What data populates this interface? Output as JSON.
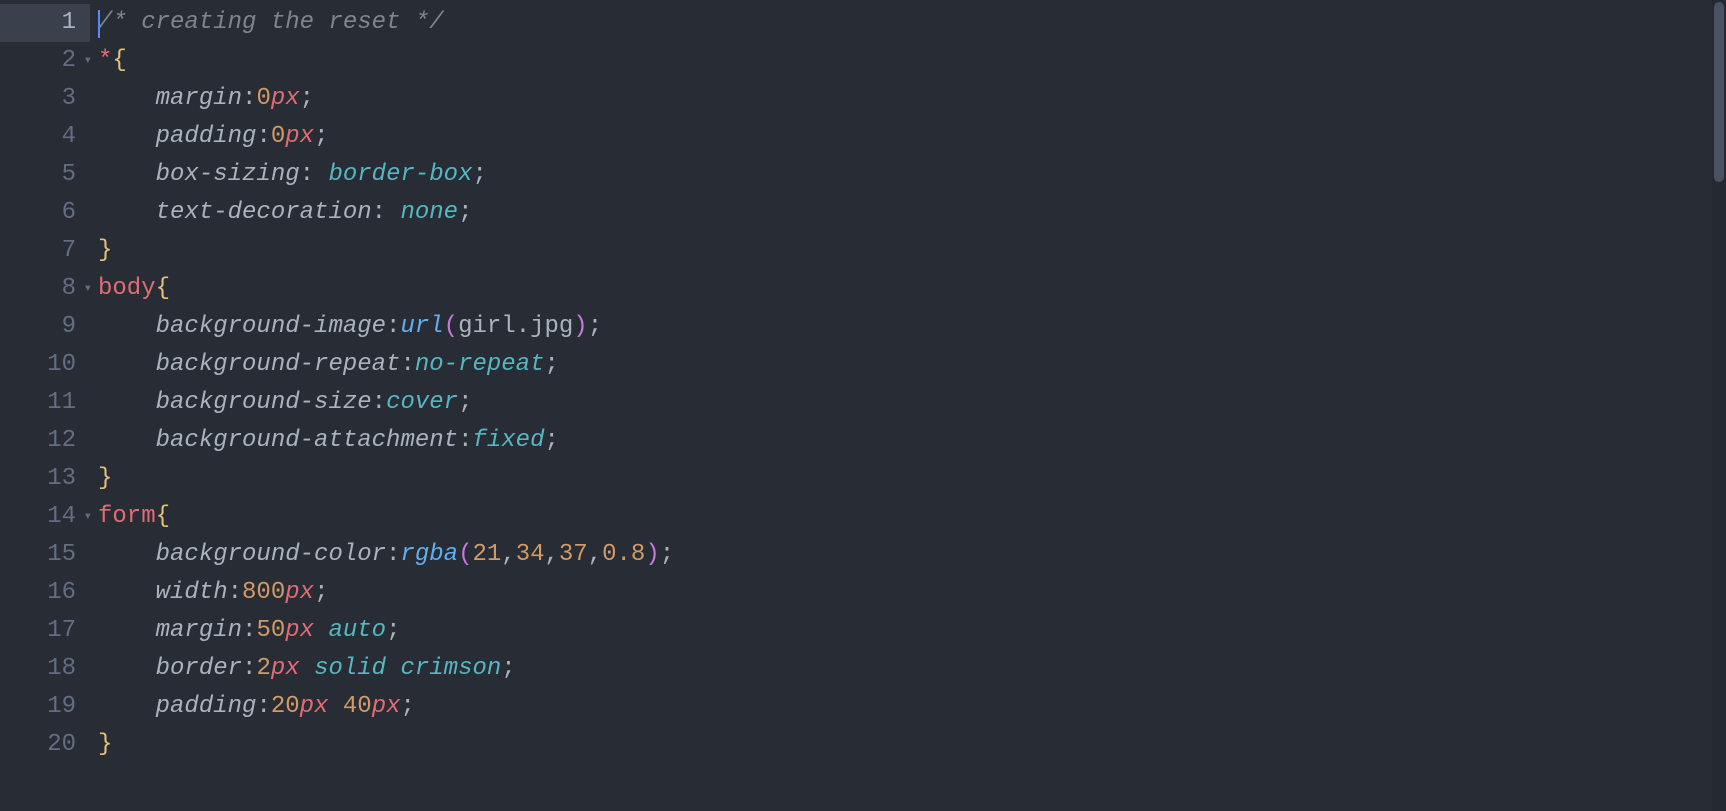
{
  "editor": {
    "language": "css",
    "active_line": 1,
    "cursor_line": 1,
    "cursor_col": 0,
    "fold_lines": [
      2,
      8,
      14
    ],
    "lines": [
      {
        "num": 1,
        "tokens": [
          {
            "t": "comment",
            "v": "/* creating the reset */"
          }
        ]
      },
      {
        "num": 2,
        "tokens": [
          {
            "t": "selector",
            "v": "*"
          },
          {
            "t": "brace",
            "v": "{"
          }
        ]
      },
      {
        "num": 3,
        "tokens": [
          {
            "t": "indent",
            "v": "    "
          },
          {
            "t": "prop",
            "v": "margin"
          },
          {
            "t": "punct",
            "v": ":"
          },
          {
            "t": "number",
            "v": "0"
          },
          {
            "t": "unit",
            "v": "px"
          },
          {
            "t": "punct",
            "v": ";"
          }
        ]
      },
      {
        "num": 4,
        "tokens": [
          {
            "t": "indent",
            "v": "    "
          },
          {
            "t": "prop",
            "v": "padding"
          },
          {
            "t": "punct",
            "v": ":"
          },
          {
            "t": "number",
            "v": "0"
          },
          {
            "t": "unit",
            "v": "px"
          },
          {
            "t": "punct",
            "v": ";"
          }
        ]
      },
      {
        "num": 5,
        "tokens": [
          {
            "t": "indent",
            "v": "    "
          },
          {
            "t": "prop",
            "v": "box-sizing"
          },
          {
            "t": "punct",
            "v": ": "
          },
          {
            "t": "const",
            "v": "border-box"
          },
          {
            "t": "punct",
            "v": ";"
          }
        ]
      },
      {
        "num": 6,
        "tokens": [
          {
            "t": "indent",
            "v": "    "
          },
          {
            "t": "prop",
            "v": "text-decoration"
          },
          {
            "t": "punct",
            "v": ": "
          },
          {
            "t": "const",
            "v": "none"
          },
          {
            "t": "punct",
            "v": ";"
          }
        ]
      },
      {
        "num": 7,
        "tokens": [
          {
            "t": "brace",
            "v": "}"
          }
        ]
      },
      {
        "num": 8,
        "tokens": [
          {
            "t": "selector",
            "v": "body"
          },
          {
            "t": "brace",
            "v": "{"
          }
        ]
      },
      {
        "num": 9,
        "tokens": [
          {
            "t": "indent",
            "v": "    "
          },
          {
            "t": "prop",
            "v": "background-image"
          },
          {
            "t": "punct",
            "v": ":"
          },
          {
            "t": "func",
            "v": "url"
          },
          {
            "t": "paren",
            "v": "("
          },
          {
            "t": "string",
            "v": "girl.jpg"
          },
          {
            "t": "paren",
            "v": ")"
          },
          {
            "t": "punct",
            "v": ";"
          }
        ]
      },
      {
        "num": 10,
        "tokens": [
          {
            "t": "indent",
            "v": "    "
          },
          {
            "t": "prop",
            "v": "background-repeat"
          },
          {
            "t": "punct",
            "v": ":"
          },
          {
            "t": "const",
            "v": "no-repeat"
          },
          {
            "t": "punct",
            "v": ";"
          }
        ]
      },
      {
        "num": 11,
        "tokens": [
          {
            "t": "indent",
            "v": "    "
          },
          {
            "t": "prop",
            "v": "background-size"
          },
          {
            "t": "punct",
            "v": ":"
          },
          {
            "t": "const",
            "v": "cover"
          },
          {
            "t": "punct",
            "v": ";"
          }
        ]
      },
      {
        "num": 12,
        "tokens": [
          {
            "t": "indent",
            "v": "    "
          },
          {
            "t": "prop",
            "v": "background-attachment"
          },
          {
            "t": "punct",
            "v": ":"
          },
          {
            "t": "const",
            "v": "fixed"
          },
          {
            "t": "punct",
            "v": ";"
          }
        ]
      },
      {
        "num": 13,
        "tokens": [
          {
            "t": "brace",
            "v": "}"
          }
        ]
      },
      {
        "num": 14,
        "tokens": [
          {
            "t": "selector",
            "v": "form"
          },
          {
            "t": "brace",
            "v": "{"
          }
        ]
      },
      {
        "num": 15,
        "tokens": [
          {
            "t": "indent",
            "v": "    "
          },
          {
            "t": "prop",
            "v": "background-color"
          },
          {
            "t": "punct",
            "v": ":"
          },
          {
            "t": "func",
            "v": "rgba"
          },
          {
            "t": "paren",
            "v": "("
          },
          {
            "t": "number",
            "v": "21"
          },
          {
            "t": "sep",
            "v": ","
          },
          {
            "t": "number",
            "v": "34"
          },
          {
            "t": "sep",
            "v": ","
          },
          {
            "t": "number",
            "v": "37"
          },
          {
            "t": "sep",
            "v": ","
          },
          {
            "t": "number",
            "v": "0.8"
          },
          {
            "t": "paren",
            "v": ")"
          },
          {
            "t": "punct",
            "v": ";"
          }
        ]
      },
      {
        "num": 16,
        "tokens": [
          {
            "t": "indent",
            "v": "    "
          },
          {
            "t": "prop",
            "v": "width"
          },
          {
            "t": "punct",
            "v": ":"
          },
          {
            "t": "number",
            "v": "800"
          },
          {
            "t": "unit",
            "v": "px"
          },
          {
            "t": "punct",
            "v": ";"
          }
        ]
      },
      {
        "num": 17,
        "tokens": [
          {
            "t": "indent",
            "v": "    "
          },
          {
            "t": "prop",
            "v": "margin"
          },
          {
            "t": "punct",
            "v": ":"
          },
          {
            "t": "number",
            "v": "50"
          },
          {
            "t": "unit",
            "v": "px"
          },
          {
            "t": "plain",
            "v": " "
          },
          {
            "t": "const",
            "v": "auto"
          },
          {
            "t": "punct",
            "v": ";"
          }
        ]
      },
      {
        "num": 18,
        "tokens": [
          {
            "t": "indent",
            "v": "    "
          },
          {
            "t": "prop",
            "v": "border"
          },
          {
            "t": "punct",
            "v": ":"
          },
          {
            "t": "number",
            "v": "2"
          },
          {
            "t": "unit",
            "v": "px"
          },
          {
            "t": "plain",
            "v": " "
          },
          {
            "t": "const",
            "v": "solid crimson"
          },
          {
            "t": "punct",
            "v": ";"
          }
        ]
      },
      {
        "num": 19,
        "tokens": [
          {
            "t": "indent",
            "v": "    "
          },
          {
            "t": "prop",
            "v": "padding"
          },
          {
            "t": "punct",
            "v": ":"
          },
          {
            "t": "number",
            "v": "20"
          },
          {
            "t": "unit",
            "v": "px"
          },
          {
            "t": "plain",
            "v": " "
          },
          {
            "t": "number",
            "v": "40"
          },
          {
            "t": "unit",
            "v": "px"
          },
          {
            "t": "punct",
            "v": ";"
          }
        ]
      },
      {
        "num": 20,
        "tokens": [
          {
            "t": "brace",
            "v": "}"
          }
        ]
      }
    ]
  },
  "colors": {
    "background": "#282c34",
    "gutter_fg": "#636d83",
    "active_line_bg": "#3a404c",
    "comment": "#7f848e",
    "selector": "#e06c75",
    "brace": "#e5c07b",
    "number": "#d19a66",
    "unit": "#e06c75",
    "const": "#56b6c2",
    "func": "#61afef",
    "paren": "#c678dd",
    "default": "#abb2bf"
  }
}
